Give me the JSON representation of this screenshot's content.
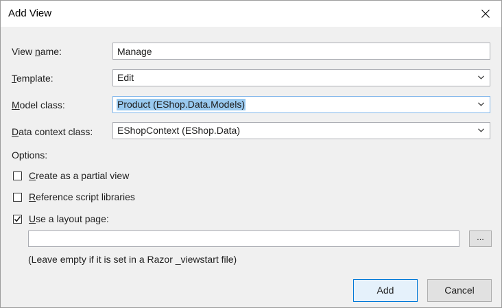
{
  "dialog": {
    "title": "Add View"
  },
  "fields": {
    "view_name": {
      "label_mnemonic": "V",
      "label_pre": "View ",
      "label_mn": "n",
      "label_post": "ame:",
      "value": "Manage"
    },
    "template": {
      "label_pre": "",
      "label_mn": "T",
      "label_post": "emplate:",
      "value": "Edit"
    },
    "model_class": {
      "label_pre": "",
      "label_mn": "M",
      "label_post": "odel class:",
      "value": "Product (EShop.Data.Models)"
    },
    "data_context_class": {
      "label_pre": "",
      "label_mn": "D",
      "label_post": "ata context class:",
      "value": "EShopContext (EShop.Data)"
    }
  },
  "options": {
    "label": "Options:",
    "partial_view": {
      "mn": "C",
      "rest": "reate as a partial view",
      "checked": false
    },
    "script_libraries": {
      "mn": "R",
      "rest": "eference script libraries",
      "checked": false
    },
    "layout_page": {
      "mn": "U",
      "rest": "se a layout page:",
      "checked": true
    },
    "layout_path_value": "",
    "browse_label": "...",
    "hint": "(Leave empty if it is set in a Razor _viewstart file)"
  },
  "buttons": {
    "add": "Add",
    "cancel": "Cancel"
  },
  "colors": {
    "selection_highlight": "#99c9ef",
    "default_button_border": "#0078d7",
    "default_button_bg": "#e5f1fb"
  },
  "icons": {
    "close": "close-icon",
    "dropdown": "chevron-down-icon",
    "check": "checkmark-icon"
  }
}
